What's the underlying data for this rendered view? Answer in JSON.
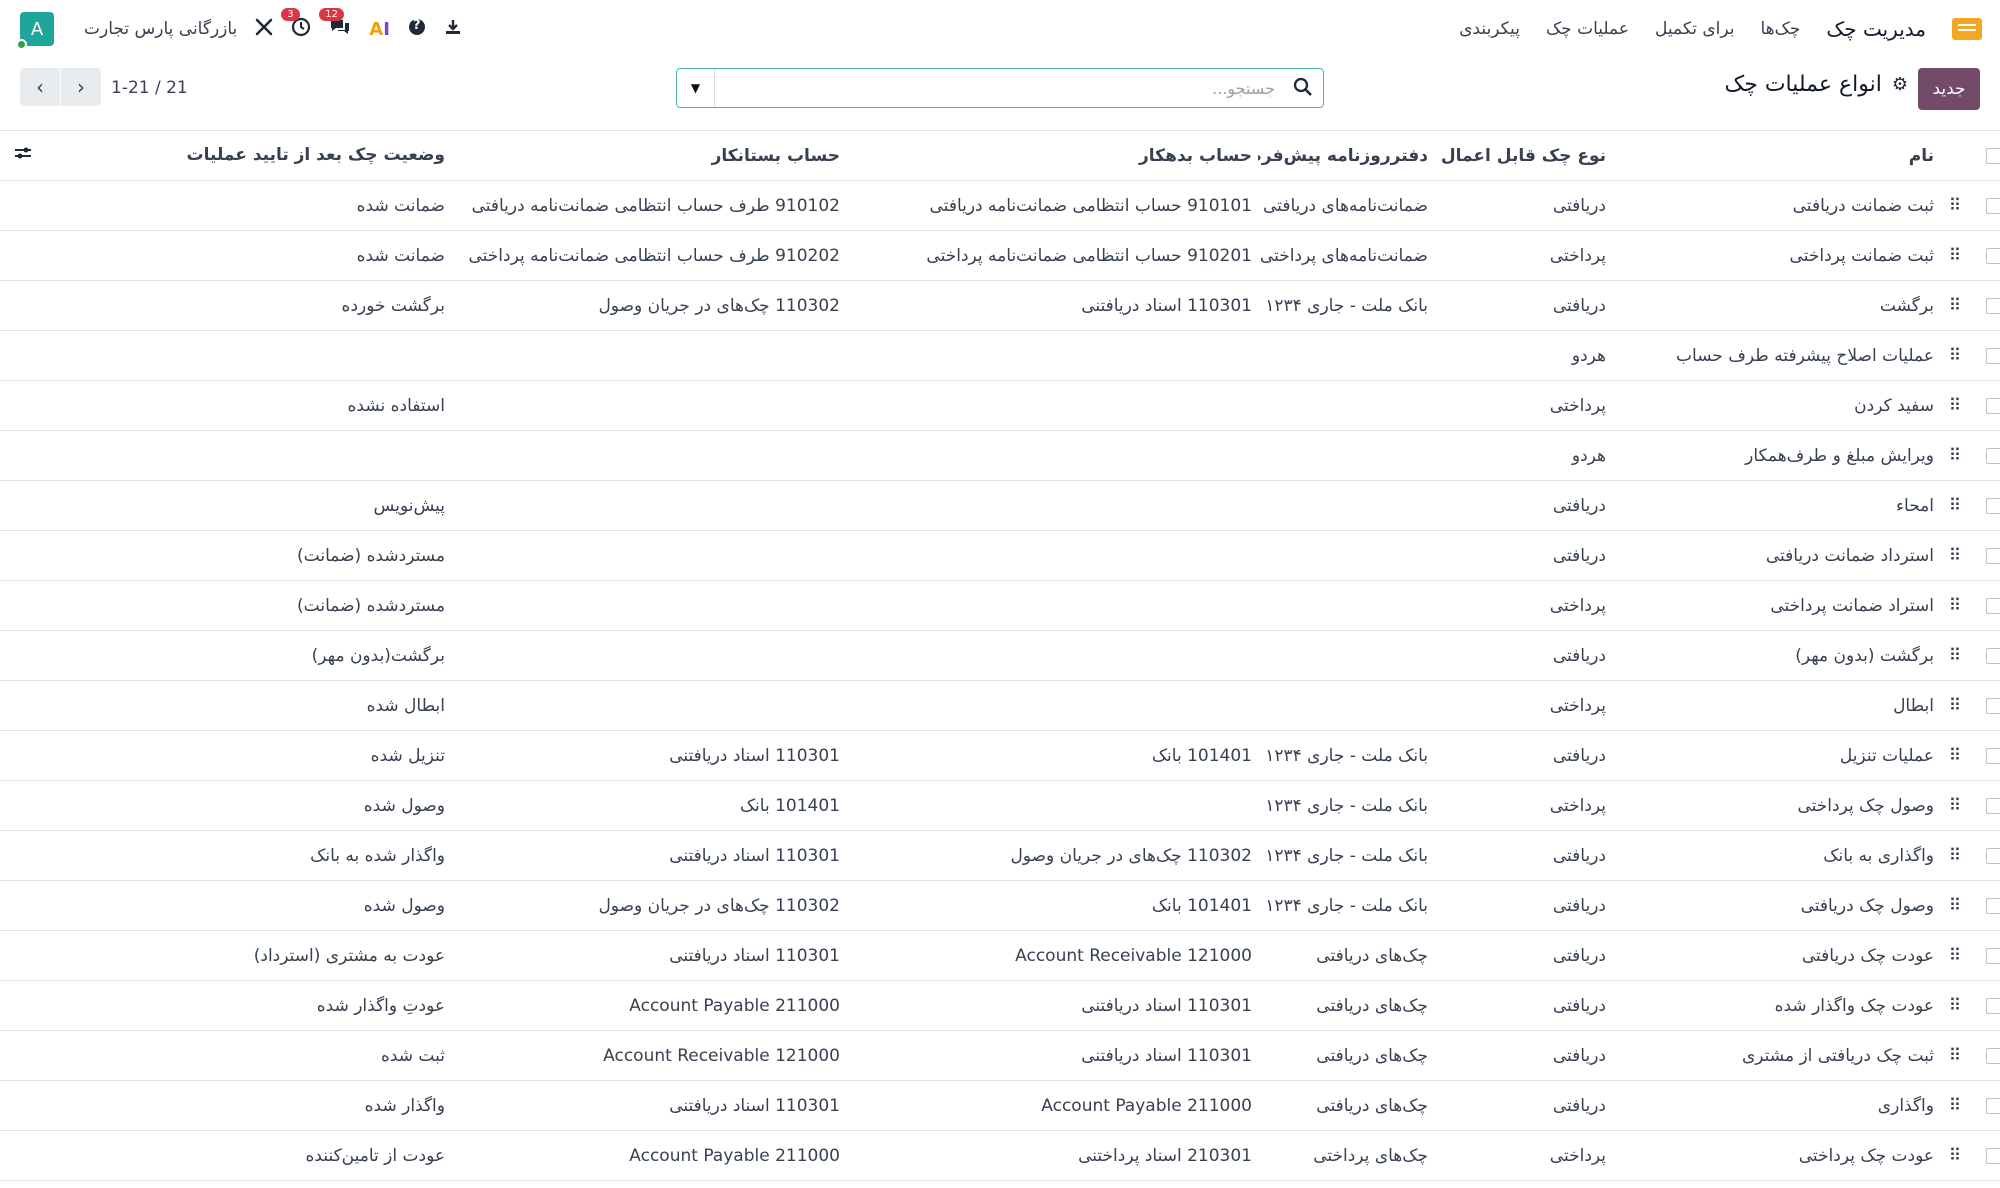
{
  "navbar": {
    "app_name": "مدیریت چک",
    "menu": [
      "چک‌ها",
      "برای تکمیل",
      "عملیات چک",
      "پیکربندی"
    ],
    "company": "بازرگانی پارس تجارت",
    "avatar_letter": "A",
    "activity_badge": "3",
    "messages_badge": "12",
    "ai_label_a": "A",
    "ai_label_i": "I",
    "help_glyph": "?"
  },
  "control": {
    "new_button": "جدید",
    "title": "انواع عملیات چک",
    "search_placeholder": "جستجو...",
    "pager": "1-21 / 21"
  },
  "table": {
    "headers": {
      "name": "نام",
      "check_type": "نوع چک قابل اعمال",
      "journal": "دفترروزنامه پیش‌فرض",
      "debit": "حساب بدهکار",
      "credit": "حساب بستانکار",
      "status": "وضعیت چک بعد از تایید عملیات"
    },
    "rows": [
      {
        "name": "ثبت ضمانت دریافتی",
        "type": "دریافتی",
        "journal": "ضمانت‌نامه‌های دریافتی",
        "debit": "910101 حساب انتظامی ضمانت‌نامه دریافتی",
        "credit": "910102 طرف حساب انتظامی ضمانت‌نامه دریافتی",
        "status": "ضمانت شده"
      },
      {
        "name": "ثبت ضمانت پرداختی",
        "type": "پرداختی",
        "journal": "ضمانت‌نامه‌های پرداختی",
        "debit": "910201 حساب انتظامی ضمانت‌نامه پرداختی",
        "credit": "910202 طرف حساب انتظامی ضمانت‌نامه پرداختی",
        "status": "ضمانت شده"
      },
      {
        "name": "برگشت",
        "type": "دریافتی",
        "journal": "بانک ملت - جاری ۱۲۳۴",
        "debit": "110301 اسناد دریافتنی",
        "credit": "110302 چک‌های در جریان وصول",
        "status": "برگشت خورده"
      },
      {
        "name": "عملیات اصلاح پیشرفته طرف حساب",
        "type": "هردو",
        "journal": "",
        "debit": "",
        "credit": "",
        "status": ""
      },
      {
        "name": "سفید کردن",
        "type": "پرداختی",
        "journal": "",
        "debit": "",
        "credit": "",
        "status": "استفاده نشده"
      },
      {
        "name": "ویرایش مبلغ و طرف‌همکار",
        "type": "هردو",
        "journal": "",
        "debit": "",
        "credit": "",
        "status": ""
      },
      {
        "name": "امحاء",
        "type": "دریافتی",
        "journal": "",
        "debit": "",
        "credit": "",
        "status": "پیش‌نویس"
      },
      {
        "name": "استرداد ضمانت دریافتی",
        "type": "دریافتی",
        "journal": "",
        "debit": "",
        "credit": "",
        "status": "مستردشده (ضمانت)"
      },
      {
        "name": "استراد ضمانت پرداختی",
        "type": "پرداختی",
        "journal": "",
        "debit": "",
        "credit": "",
        "status": "مستردشده (ضمانت)"
      },
      {
        "name": "برگشت (بدون مهر)",
        "type": "دریافتی",
        "journal": "",
        "debit": "",
        "credit": "",
        "status": "برگشت(بدون مهر)"
      },
      {
        "name": "ابطال",
        "type": "پرداختی",
        "journal": "",
        "debit": "",
        "credit": "",
        "status": "ابطال شده"
      },
      {
        "name": "عملیات تنزیل",
        "type": "دریافتی",
        "journal": "بانک ملت - جاری ۱۲۳۴",
        "debit": "101401 بانک",
        "credit": "110301 اسناد دریافتنی",
        "status": "تنزیل شده"
      },
      {
        "name": "وصول چک پرداختی",
        "type": "پرداختی",
        "journal": "بانک ملت - جاری ۱۲۳۴",
        "debit": "",
        "credit": "101401 بانک",
        "status": "وصول شده"
      },
      {
        "name": "واگذاری به بانک",
        "type": "دریافتی",
        "journal": "بانک ملت - جاری ۱۲۳۴",
        "debit": "110302 چک‌های در جریان وصول",
        "credit": "110301 اسناد دریافتنی",
        "status": "واگذار شده به بانک"
      },
      {
        "name": "وصول چک دریافتی",
        "type": "دریافتی",
        "journal": "بانک ملت - جاری ۱۲۳۴",
        "debit": "101401 بانک",
        "credit": "110302 چک‌های در جریان وصول",
        "status": "وصول شده"
      },
      {
        "name": "عودت چک دریافتی",
        "type": "دریافتی",
        "journal": "چک‌های دریافتی",
        "debit": "121000 Account Receivable",
        "credit": "110301 اسناد دریافتنی",
        "status": "عودت به مشتری (استرداد)"
      },
      {
        "name": "عودت چک واگذار شده",
        "type": "دریافتی",
        "journal": "چک‌های دریافتی",
        "debit": "110301 اسناد دریافتنی",
        "credit": "211000 Account Payable",
        "status": "عودتِ واگذار شده"
      },
      {
        "name": "ثبت چک دریافتی از مشتری",
        "type": "دریافتی",
        "journal": "چک‌های دریافتی",
        "debit": "110301 اسناد دریافتنی",
        "credit": "121000 Account Receivable",
        "status": "ثبت شده"
      },
      {
        "name": "واگذاری",
        "type": "دریافتی",
        "journal": "چک‌های دریافتی",
        "debit": "211000 Account Payable",
        "credit": "110301 اسناد دریافتنی",
        "status": "واگذار شده"
      },
      {
        "name": "عودت چک پرداختی",
        "type": "پرداختی",
        "journal": "چک‌های پرداختی",
        "debit": "210301 اسناد پرداختنی",
        "credit": "211000 Account Payable",
        "status": "عودت از تامین‌کننده"
      }
    ]
  },
  "icons": {
    "drag_handle": "⠿",
    "settings_gear": "⚙",
    "optional_columns": "⇄"
  }
}
